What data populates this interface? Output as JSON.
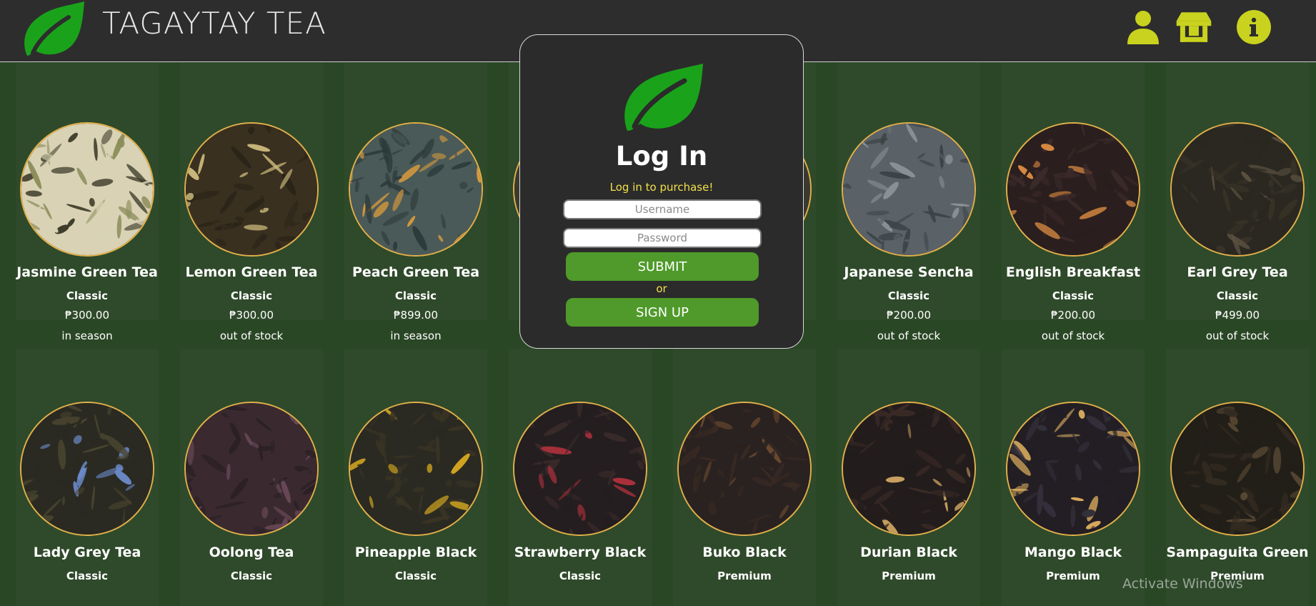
{
  "app": {
    "brand": "TAGAYTAY TEA",
    "accent_color": "#c9d21e",
    "leaf_color": "#1aa31a"
  },
  "nav": {
    "icons": [
      "user-icon",
      "store-icon",
      "info-icon"
    ]
  },
  "login_modal": {
    "title": "Log In",
    "subtitle": "Log in to purchase!",
    "username_placeholder": "Username",
    "password_placeholder": "Password",
    "submit_label": "SUBMIT",
    "or_label": "or",
    "signup_label": "SIGN UP"
  },
  "products_row1": [
    {
      "name": "Jasmine Green Tea",
      "tier": "Classic",
      "price": "₱300.00",
      "status": "in season",
      "swatch": [
        "#d9d2b5",
        "#3b3a28",
        "#8b8d5a"
      ]
    },
    {
      "name": "Lemon Green Tea",
      "tier": "Classic",
      "price": "₱300.00",
      "status": "out of stock",
      "swatch": [
        "#3a3020",
        "#c9b77a",
        "#2b2418"
      ]
    },
    {
      "name": "Peach Green Tea",
      "tier": "Classic",
      "price": "₱899.00",
      "status": "in season",
      "swatch": [
        "#4a5a58",
        "#d89a3c",
        "#2c3a3a"
      ]
    },
    {
      "name": "",
      "tier": "",
      "price": "",
      "status": "",
      "swatch": [
        "#3a3a30",
        "#6b5a40",
        "#2a2a22"
      ]
    },
    {
      "name": "",
      "tier": "",
      "price": "",
      "status": "",
      "swatch": [
        "#3a3a30",
        "#6b5a40",
        "#2a2a22"
      ]
    },
    {
      "name": "Japanese Sencha",
      "tier": "Classic",
      "price": "₱200.00",
      "status": "out of stock",
      "swatch": [
        "#5a6268",
        "#8a9296",
        "#3b4246"
      ]
    },
    {
      "name": "English Breakfast",
      "tier": "Classic",
      "price": "₱200.00",
      "status": "out of stock",
      "swatch": [
        "#2a1e1e",
        "#d98a40",
        "#3b2a2a"
      ]
    },
    {
      "name": "Earl Grey Tea",
      "tier": "Classic",
      "price": "₱499.00",
      "status": "out of stock",
      "swatch": [
        "#2a2820",
        "#5a5040",
        "#3a3428"
      ]
    }
  ],
  "products_row2": [
    {
      "name": "Lady Grey Tea",
      "tier": "Classic",
      "swatch": [
        "#2a2a22",
        "#6b8ac9",
        "#4a4630"
      ]
    },
    {
      "name": "Oolong Tea",
      "tier": "Classic",
      "swatch": [
        "#3a2a30",
        "#6b4a5a",
        "#2a2024"
      ]
    },
    {
      "name": "Pineapple Black",
      "tier": "Classic",
      "swatch": [
        "#2a2a22",
        "#e0b020",
        "#3a3424"
      ]
    },
    {
      "name": "Strawberry Black",
      "tier": "Classic",
      "swatch": [
        "#241e20",
        "#a8303a",
        "#3a2a2a"
      ]
    },
    {
      "name": "Buko Black",
      "tier": "Premium",
      "swatch": [
        "#2a2220",
        "#6a4a30",
        "#3a2a24"
      ]
    },
    {
      "name": "Durian Black",
      "tier": "Premium",
      "swatch": [
        "#221c1c",
        "#c9a060",
        "#3a2a26"
      ]
    },
    {
      "name": "Mango Black",
      "tier": "Premium",
      "swatch": [
        "#221e24",
        "#e0b060",
        "#34303a"
      ]
    },
    {
      "name": "Sampaguita Green",
      "tier": "Premium",
      "swatch": [
        "#221e18",
        "#5a4a34",
        "#342c22"
      ]
    }
  ],
  "watermark": "Activate Windows"
}
